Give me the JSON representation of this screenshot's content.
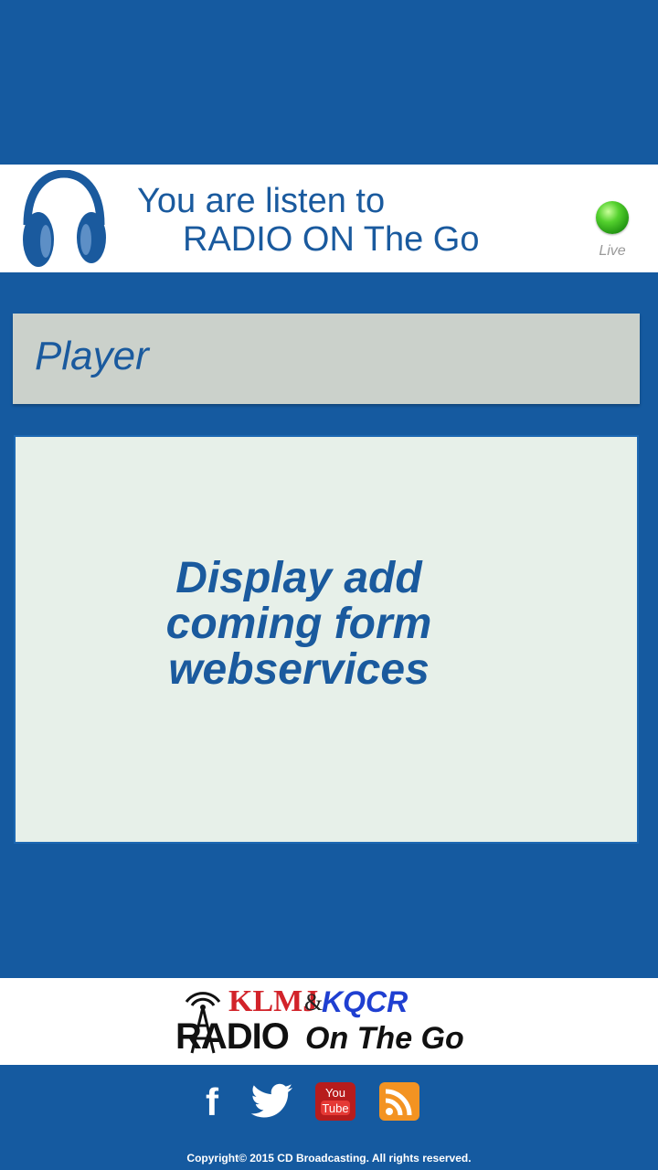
{
  "header": {
    "line1": "You are listen to",
    "line2": "RADIO ON The Go",
    "status_label": "Live",
    "status_color": "#3cc11f",
    "icon": "headphones-icon"
  },
  "player": {
    "title": "Player"
  },
  "ad": {
    "line1": "Display add",
    "line2": "coming form",
    "line3": "webservices"
  },
  "footer": {
    "logo": {
      "part1": "KLMJ",
      "ampersand": "&",
      "part2": "KQCR",
      "radio": "RADIO",
      "tagline": "On The Go"
    },
    "social": [
      {
        "name": "facebook-icon",
        "glyph": "f"
      },
      {
        "name": "twitter-icon"
      },
      {
        "name": "youtube-icon",
        "top": "You",
        "bottom": "Tube"
      },
      {
        "name": "rss-icon"
      }
    ],
    "copyright": "Copyright© 2015 CD Broadcasting. All rights reserved."
  },
  "colors": {
    "background": "#155aa0",
    "text_blue": "#1a5a9e",
    "ad_panel": "#e7f0e9",
    "player_bar": "#cbd1cb"
  }
}
